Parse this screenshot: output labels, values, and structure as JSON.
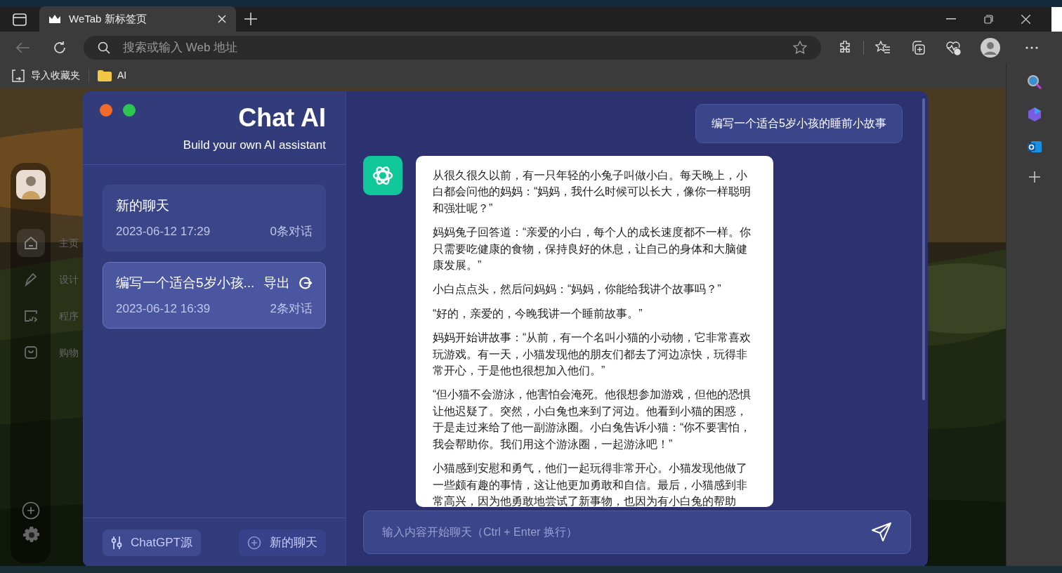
{
  "browser": {
    "tab_title": "WeTab 新标签页",
    "address_placeholder": "搜索或输入 Web 地址",
    "bookmarks": [
      {
        "kind": "import",
        "label": "导入收藏夹"
      },
      {
        "kind": "folder",
        "label": "AI"
      }
    ]
  },
  "wetab_sidebar": {
    "items": [
      {
        "label": "主页",
        "selected": true
      },
      {
        "label": "设计",
        "selected": false
      },
      {
        "label": "程序",
        "selected": false
      },
      {
        "label": "购物",
        "selected": false
      }
    ]
  },
  "app": {
    "title": "Chat AI",
    "subtitle": "Build your own AI assistant",
    "conversations": [
      {
        "title": "新的聊天",
        "time": "2023-06-12 17:29",
        "count": "0条对话",
        "selected": false
      },
      {
        "title": "编写一个适合5岁小孩...",
        "time": "2023-06-12 16:39",
        "count": "2条对话",
        "selected": true,
        "action": "导出"
      }
    ],
    "footer_buttons": [
      {
        "kind": "source",
        "label": "ChatGPT源"
      },
      {
        "kind": "new",
        "label": "新的聊天"
      }
    ],
    "messages": [
      {
        "kind": "user",
        "paragraphs": [
          "编写一个适合5岁小孩的睡前小故事"
        ]
      },
      {
        "kind": "assistant",
        "paragraphs": [
          "从很久很久以前，有一只年轻的小兔子叫做小白。每天晚上，小白都会问他的妈妈：“妈妈，我什么时候可以长大，像你一样聪明和强壮呢？”",
          "妈妈兔子回答道：“亲爱的小白，每个人的成长速度都不一样。你只需要吃健康的食物，保持良好的休息，让自己的身体和大脑健康发展。”",
          "小白点点头，然后问妈妈：“妈妈，你能给我讲个故事吗？”",
          "“好的，亲爱的，今晚我讲一个睡前故事。”",
          "妈妈开始讲故事：“从前，有一个名叫小猫的小动物，它非常喜欢玩游戏。有一天，小猫发现他的朋友们都去了河边凉快，玩得非常开心，于是他也很想加入他们。”",
          "“但小猫不会游泳，他害怕会淹死。他很想参加游戏，但他的恐惧让他迟疑了。突然，小白兔也来到了河边。他看到小猫的困惑，于是走过来给了他一副游泳圈。小白兔告诉小猫：“你不要害怕，我会帮助你。我们用这个游泳圈，一起游泳吧！”",
          "小猫感到安慰和勇气，他们一起玩得非常开心。小猫发现他做了一些颇有趣的事情，这让他更加勇敢和自信。最后，小猫感到非常高兴，因为他勇敢地尝试了新事物，也因为有小白兔的帮助"
        ]
      }
    ],
    "input_placeholder": "输入内容开始聊天（Ctrl + Enter 换行）"
  }
}
